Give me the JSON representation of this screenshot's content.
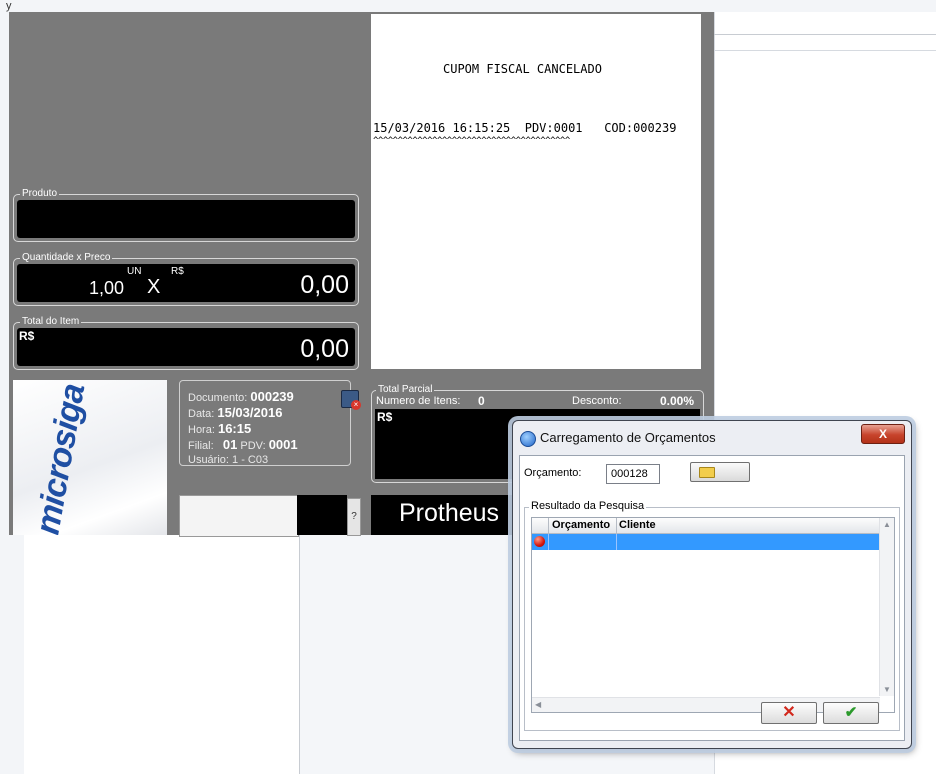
{
  "background": {
    "corner_glyph": "y"
  },
  "pos": {
    "produto": {
      "label": "Produto",
      "value": ""
    },
    "quantidade_preco": {
      "label": "Quantidade x Preco",
      "quantity": "1,00",
      "unit": "UN",
      "times": "X",
      "currency": "R$",
      "value": "0,00"
    },
    "total_item": {
      "label": "Total do Item",
      "currency": "R$",
      "value": "0,00"
    },
    "receipt": {
      "title": "CUPOM FISCAL CANCELADO",
      "line1": "15/03/2016 16:15:25  PDV:0001   COD:000239",
      "line2": "^^^^^^^^^^^^^^^^^^^^^^^^^^^^^^^^^^^^^^^^"
    },
    "logo_text": "microsiga",
    "doc": {
      "documento_label": "Documento:",
      "documento": "000239",
      "data_label": "Data:",
      "data": "15/03/2016",
      "hora_label": "Hora:",
      "hora": "16:15",
      "filial_label": "Filial:",
      "filial": "01",
      "pdv_label": "PDV:",
      "pdv": "0001",
      "usuario_label": "Usuário:",
      "usuario": "1 - C03"
    },
    "total_parcial": {
      "label": "Total Parcial",
      "itens_label": "Numero de Itens:",
      "itens": "0",
      "desconto_label": "Desconto:",
      "desconto": "0.00%",
      "currency": "R$"
    },
    "help": "?",
    "product_name": "Protheus"
  },
  "dialog": {
    "title": "Carregamento de Orçamentos",
    "close": "X",
    "orcamento_label": "Orçamento:",
    "orcamento_value": "000128",
    "results_legend": "Resultado da Pesquisa",
    "columns": [
      "Orçamento",
      "Cliente"
    ],
    "cancel": "✕",
    "ok": "✔"
  }
}
